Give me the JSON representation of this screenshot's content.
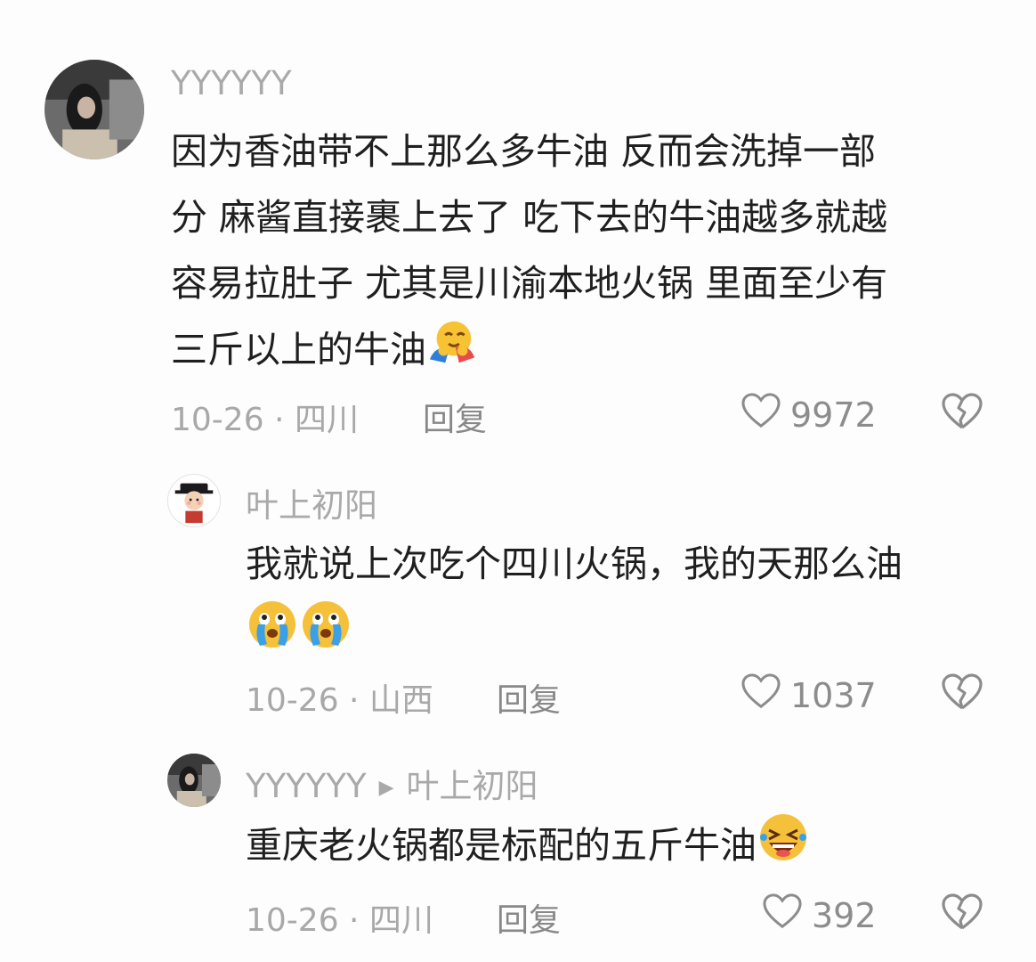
{
  "comments": [
    {
      "user": "YYYYYY",
      "lines": [
        "因为香油带不上那么多牛油 反而会洗掉一部",
        "分 麻酱直接裹上去了 吃下去的牛油越多就越",
        "容易拉肚子 尤其是川渝本地火锅 里面至少有",
        "三斤以上的牛油"
      ],
      "meta": "10-26 · 四川",
      "reply_label": "回复",
      "likes": "9972"
    },
    {
      "user": "叶上初阳",
      "lines": [
        "我就说上次吃个四川火锅，我的天那么油"
      ],
      "meta": "10-26 · 山西",
      "reply_label": "回复",
      "likes": "1037"
    },
    {
      "user": "YYYYYY",
      "reply_to": "叶上初阳",
      "lines": [
        "重庆老火锅都是标配的五斤牛油"
      ],
      "meta": "10-26 · 四川",
      "reply_label": "回复",
      "likes": "392"
    }
  ],
  "colors": {
    "background": "#fdfdfd",
    "username": "#a9a9a9",
    "text": "#1f1f1f",
    "meta": "#a8a8a8"
  }
}
